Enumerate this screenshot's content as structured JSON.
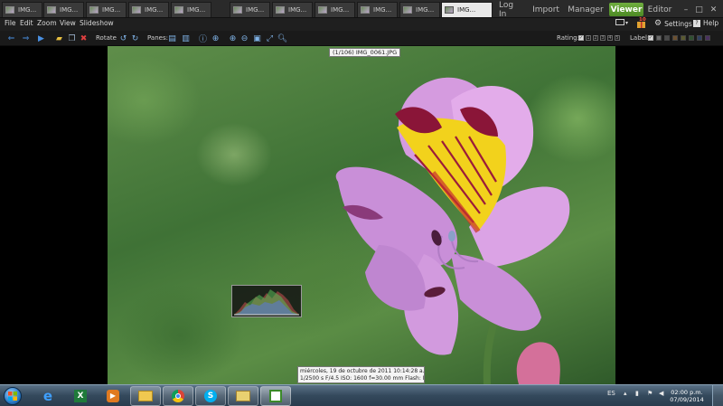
{
  "doc_tabs": [
    {
      "label": "IMG..."
    },
    {
      "label": "IMG..."
    },
    {
      "label": "IMG..."
    },
    {
      "label": "IMG..."
    },
    {
      "label": "IMG..."
    },
    {
      "label": "IMG..."
    },
    {
      "label": "IMG..."
    },
    {
      "label": "IMG..."
    },
    {
      "label": "IMG..."
    },
    {
      "label": "IMG...",
      "active": true
    }
  ],
  "mode_tabs": [
    {
      "label": "Log In"
    },
    {
      "label": "Import"
    },
    {
      "label": "Manager"
    },
    {
      "label": "Viewer",
      "active": true
    },
    {
      "label": "Editor"
    }
  ],
  "menu": {
    "file": "File",
    "edit": "Edit",
    "zoom": "Zoom",
    "view": "View",
    "slideshow": "Slideshow",
    "notification_count": "10",
    "settings": "Settings",
    "help": "Help"
  },
  "toolbar": {
    "rotate_label": "Rotate",
    "panes_label": "Panes:",
    "rating_label": "Rating:",
    "rating_values": [
      "1",
      "2",
      "3",
      "4",
      "5"
    ],
    "label_label": "Label:",
    "label_colors": [
      "#6a6a6a",
      "#4a4a4a",
      "#6b5030",
      "#5a5a30",
      "#2f5030",
      "#2f3f60",
      "#4a3060"
    ]
  },
  "viewer": {
    "file_caption": "(1/106) IMG_0061.JPG",
    "info_date": "miércoles, 19 de octubre de 2011 10:14:28 a.m.",
    "info_exif": "1/2500 s F/4.5 ISO: 1600 f=30.00 mm Flash: No"
  },
  "taskbar": {
    "lang": "ES",
    "time": "02:00 p.m.",
    "date": "07/09/2014"
  },
  "colors": {
    "viewer_active": "#5e9c34",
    "flower_pink": "#c890d8",
    "flower_yellow": "#f2d21c",
    "flower_maroon": "#8a1538"
  }
}
